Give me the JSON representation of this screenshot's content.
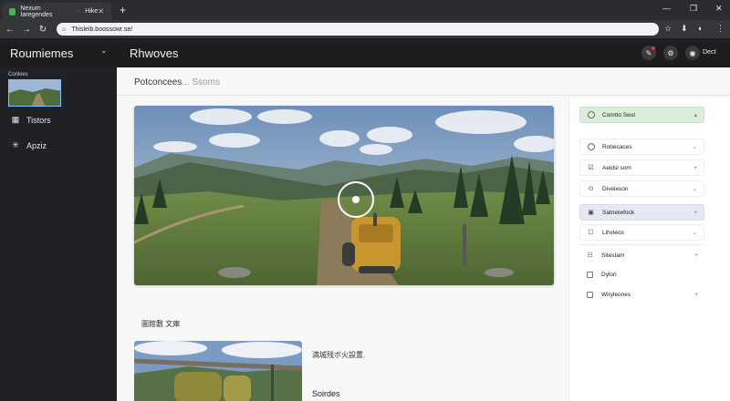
{
  "browser": {
    "tabs": [
      {
        "label": "Nexum Iaregendes"
      },
      {
        "label": "Hike"
      }
    ],
    "url": "Thisleib.boossowr.se/"
  },
  "header": {
    "app_title": "Roumiemes",
    "page_title": "Rhwoves",
    "user_name": "Dect"
  },
  "sidebar": {
    "thumb_label": "Conkies",
    "items": [
      {
        "label": "Tistors",
        "icon": "grid-icon"
      },
      {
        "label": "Apziz",
        "icon": "sparkle-icon"
      }
    ]
  },
  "main": {
    "breadcrumb": "Potconcees",
    "breadcrumb_hint": "... Ssoms",
    "caption1": "圖館敷 文庫",
    "caption2": "満城残ボ火設置.",
    "caption3": "Soirdes"
  },
  "panel": {
    "items": [
      {
        "label": "Comtto Seut",
        "icon": "circle-icon",
        "trail": "▴",
        "style": "green"
      },
      {
        "label": "Robecaces",
        "icon": "circle-icon",
        "trail": "⌄",
        "style": "plain"
      },
      {
        "label": "Aeidsl som",
        "icon": "check-icon",
        "trail": "+",
        "style": "plain"
      },
      {
        "label": "Diveleson",
        "icon": "chevron-down-icon",
        "trail": "⌄",
        "style": "plain"
      },
      {
        "label": "Satneiwfock",
        "icon": "layers-icon",
        "trail": "+",
        "style": "blue"
      },
      {
        "label": "Lihvleos",
        "icon": "checkbox-icon",
        "trail": "⌄",
        "style": "plain"
      },
      {
        "label": "Sitestam",
        "icon": "note-icon",
        "trail": "+",
        "style": "bare"
      },
      {
        "label": "Dylon",
        "icon": "checkbox-icon",
        "trail": "",
        "style": "bare"
      },
      {
        "label": "Wiryleones",
        "icon": "checkbox-icon",
        "trail": "+",
        "style": "bare"
      }
    ]
  },
  "colors": {
    "accent_green": "#dbeeda",
    "accent_blue": "#e6e9f3",
    "header_bg": "#1d1d1f"
  }
}
